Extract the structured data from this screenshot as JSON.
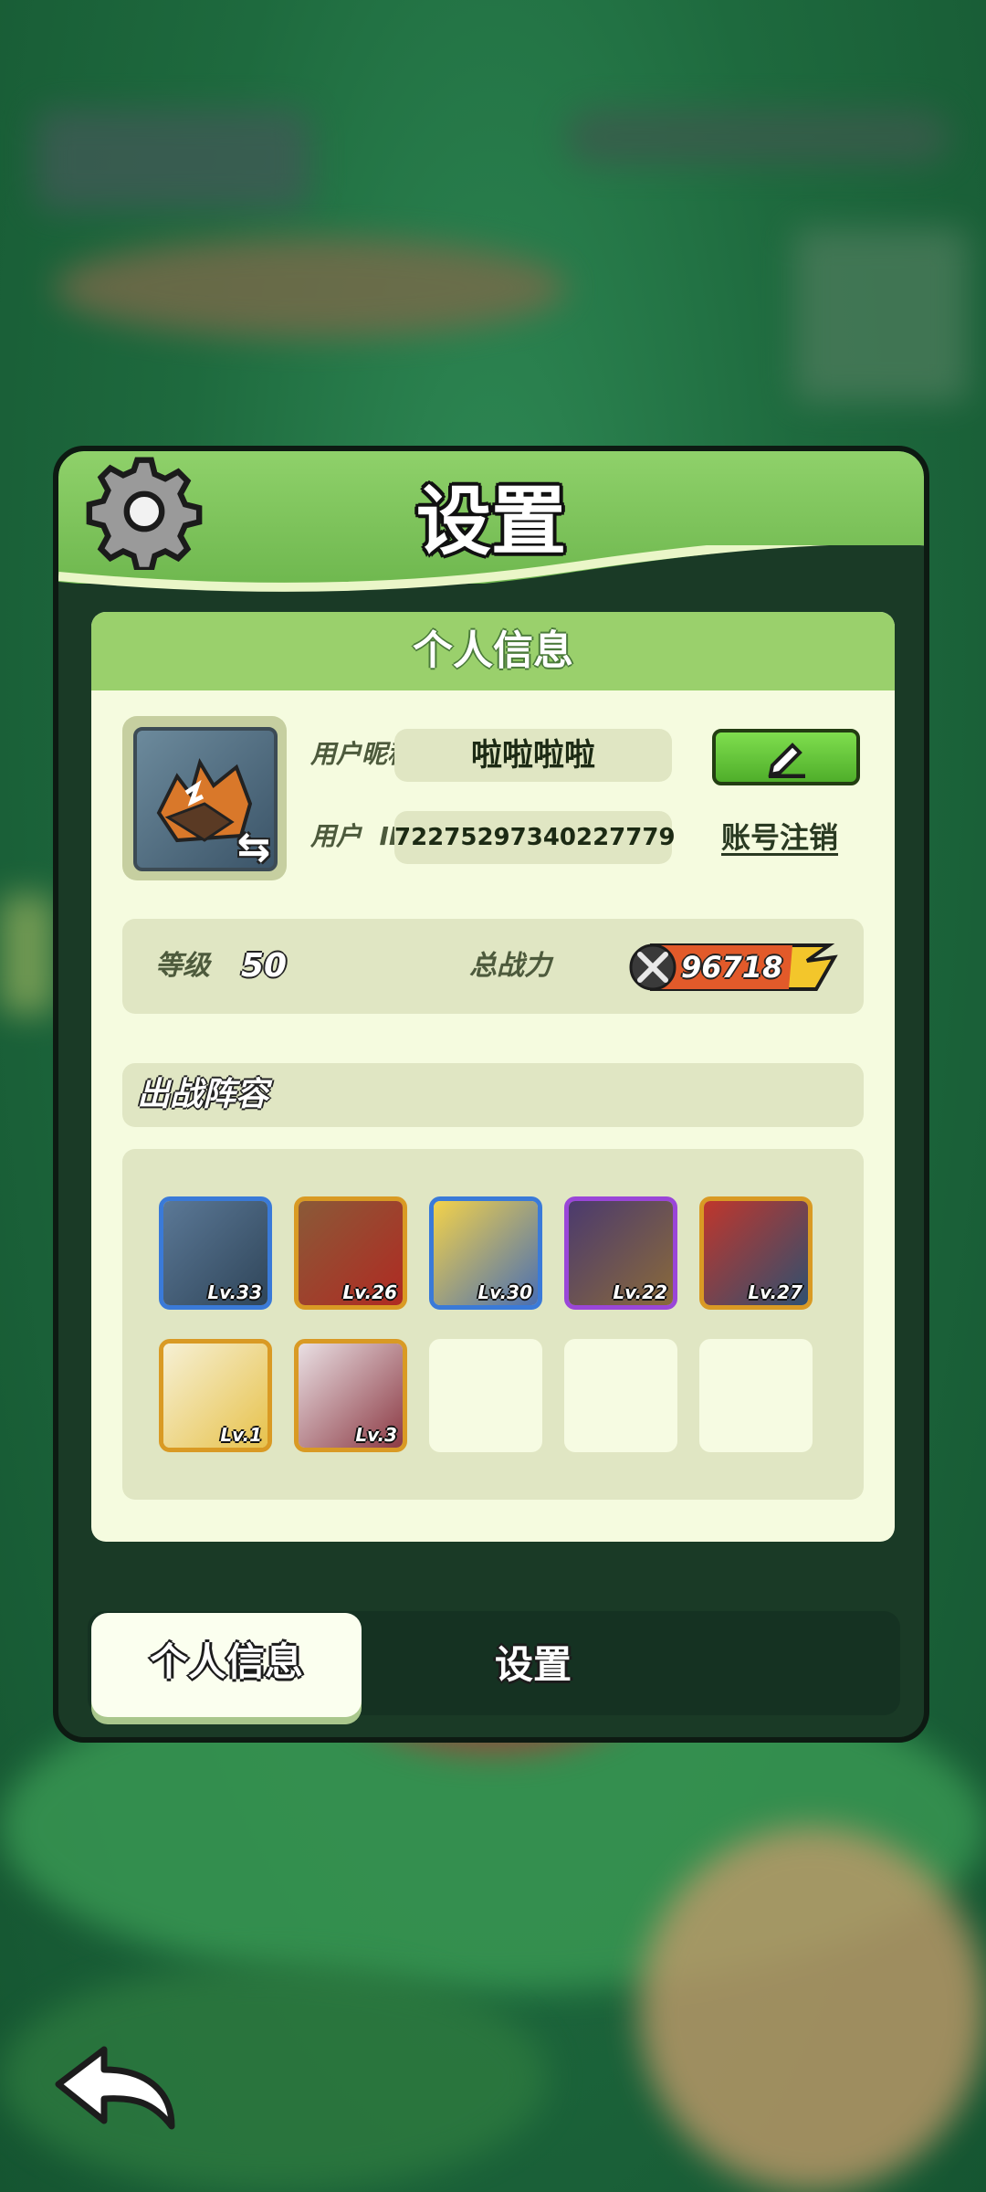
{
  "dialog": {
    "title": "设置",
    "section_header": "个人信息"
  },
  "profile": {
    "nickname_label": "用户昵称",
    "nickname": "啦啦啦啦",
    "id_label": "用户  ID",
    "user_id": "72275297340227779",
    "delete_account_link": "账号注销",
    "level_label": "等级",
    "level": "50",
    "power_label": "总战力",
    "power": "96718"
  },
  "lineup": {
    "title": "出战阵容",
    "heroes": [
      {
        "level": "Lv.33",
        "rarity": "blue"
      },
      {
        "level": "Lv.26",
        "rarity": "orange"
      },
      {
        "level": "Lv.30",
        "rarity": "blue"
      },
      {
        "level": "Lv.22",
        "rarity": "purple"
      },
      {
        "level": "Lv.27",
        "rarity": "orange"
      },
      {
        "level": "Lv.1",
        "rarity": "orange"
      },
      {
        "level": "Lv.3",
        "rarity": "orange"
      }
    ],
    "empty_slots": 3
  },
  "tabs": [
    {
      "label": "个人信息",
      "active": true
    },
    {
      "label": "设置",
      "active": false
    }
  ],
  "icons": {
    "gear": "gear-icon",
    "edit": "pencil-icon",
    "swap": "swap-arrows-icon",
    "power": "crossed-swords-icon",
    "back": "back-arrow-icon"
  },
  "colors": {
    "header_green": "#8fd16a",
    "card_bg": "#f5fbdf",
    "button_green": "#5fc236",
    "power_yellow": "#f3c62b"
  }
}
